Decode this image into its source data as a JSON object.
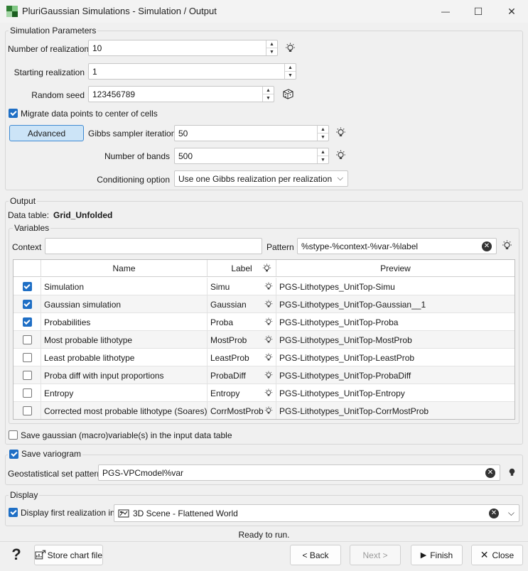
{
  "window": {
    "title": "PluriGaussian Simulations - Simulation / Output",
    "minimize_glyph": "—",
    "maximize_glyph": "☐",
    "close_glyph": "✕"
  },
  "simulation_parameters": {
    "title": "Simulation Parameters",
    "num_realizations_label": "Number of realizations",
    "num_realizations_value": "10",
    "starting_realization_label": "Starting realization",
    "starting_realization_value": "1",
    "random_seed_label": "Random seed",
    "random_seed_value": "123456789",
    "migrate_label": "Migrate data points to center of cells",
    "migrate_checked": true,
    "advanced_label": "Advanced",
    "gibbs_label": "Gibbs sampler iterations",
    "gibbs_value": "50",
    "bands_label": "Number of bands",
    "bands_value": "500",
    "conditioning_label": "Conditioning option",
    "conditioning_value": "Use one Gibbs realization per realization"
  },
  "output": {
    "title": "Output",
    "data_table_label": "Data table:",
    "data_table_value": "Grid_Unfolded",
    "variables_title": "Variables",
    "context_label": "Context",
    "context_value": "",
    "pattern_label": "Pattern",
    "pattern_value": "%stype-%context-%var-%label",
    "columns": {
      "name": "Name",
      "label": "Label",
      "preview": "Preview"
    },
    "rows": [
      {
        "checked": true,
        "name": "Simulation",
        "label": "Simu",
        "preview": "PGS-Lithotypes_UnitTop-Simu"
      },
      {
        "checked": true,
        "name": "Gaussian simulation",
        "label": "Gaussian",
        "preview": "PGS-Lithotypes_UnitTop-Gaussian__1"
      },
      {
        "checked": true,
        "name": "Probabilities",
        "label": "Proba",
        "preview": "PGS-Lithotypes_UnitTop-Proba"
      },
      {
        "checked": false,
        "name": "Most probable lithotype",
        "label": "MostProb",
        "preview": "PGS-Lithotypes_UnitTop-MostProb"
      },
      {
        "checked": false,
        "name": "Least probable lithotype",
        "label": "LeastProb",
        "preview": "PGS-Lithotypes_UnitTop-LeastProb"
      },
      {
        "checked": false,
        "name": "Proba diff with input proportions",
        "label": "ProbaDiff",
        "preview": "PGS-Lithotypes_UnitTop-ProbaDiff"
      },
      {
        "checked": false,
        "name": "Entropy",
        "label": "Entropy",
        "preview": "PGS-Lithotypes_UnitTop-Entropy"
      },
      {
        "checked": false,
        "name": "Corrected most probable lithotype (Soares)",
        "label": "CorrMostProb",
        "preview": "PGS-Lithotypes_UnitTop-CorrMostProb"
      }
    ],
    "save_gaussian_label": "Save gaussian (macro)variable(s) in the input data table",
    "save_gaussian_checked": false
  },
  "variogram": {
    "save_label": "Save variogram",
    "save_checked": true,
    "pattern_label": "Geostatistical set pattern",
    "pattern_value": "PGS-VPCmodel%var"
  },
  "display": {
    "title": "Display",
    "first_realization_label": "Display first realization in",
    "first_realization_checked": true,
    "scene_value": "3D Scene - Flattened World"
  },
  "status_text": "Ready to run.",
  "footer": {
    "help_glyph": "?",
    "store_chart_label": "Store chart file",
    "back_label": "< Back",
    "next_label": "Next >",
    "finish_label": "Finish",
    "close_label": "Close"
  },
  "icons": {
    "clear_glyph": "✕",
    "dropdown_glyph": "⌵"
  },
  "colors": {
    "accent": "#1f6fc5",
    "advanced_bg": "#cce4f7"
  }
}
